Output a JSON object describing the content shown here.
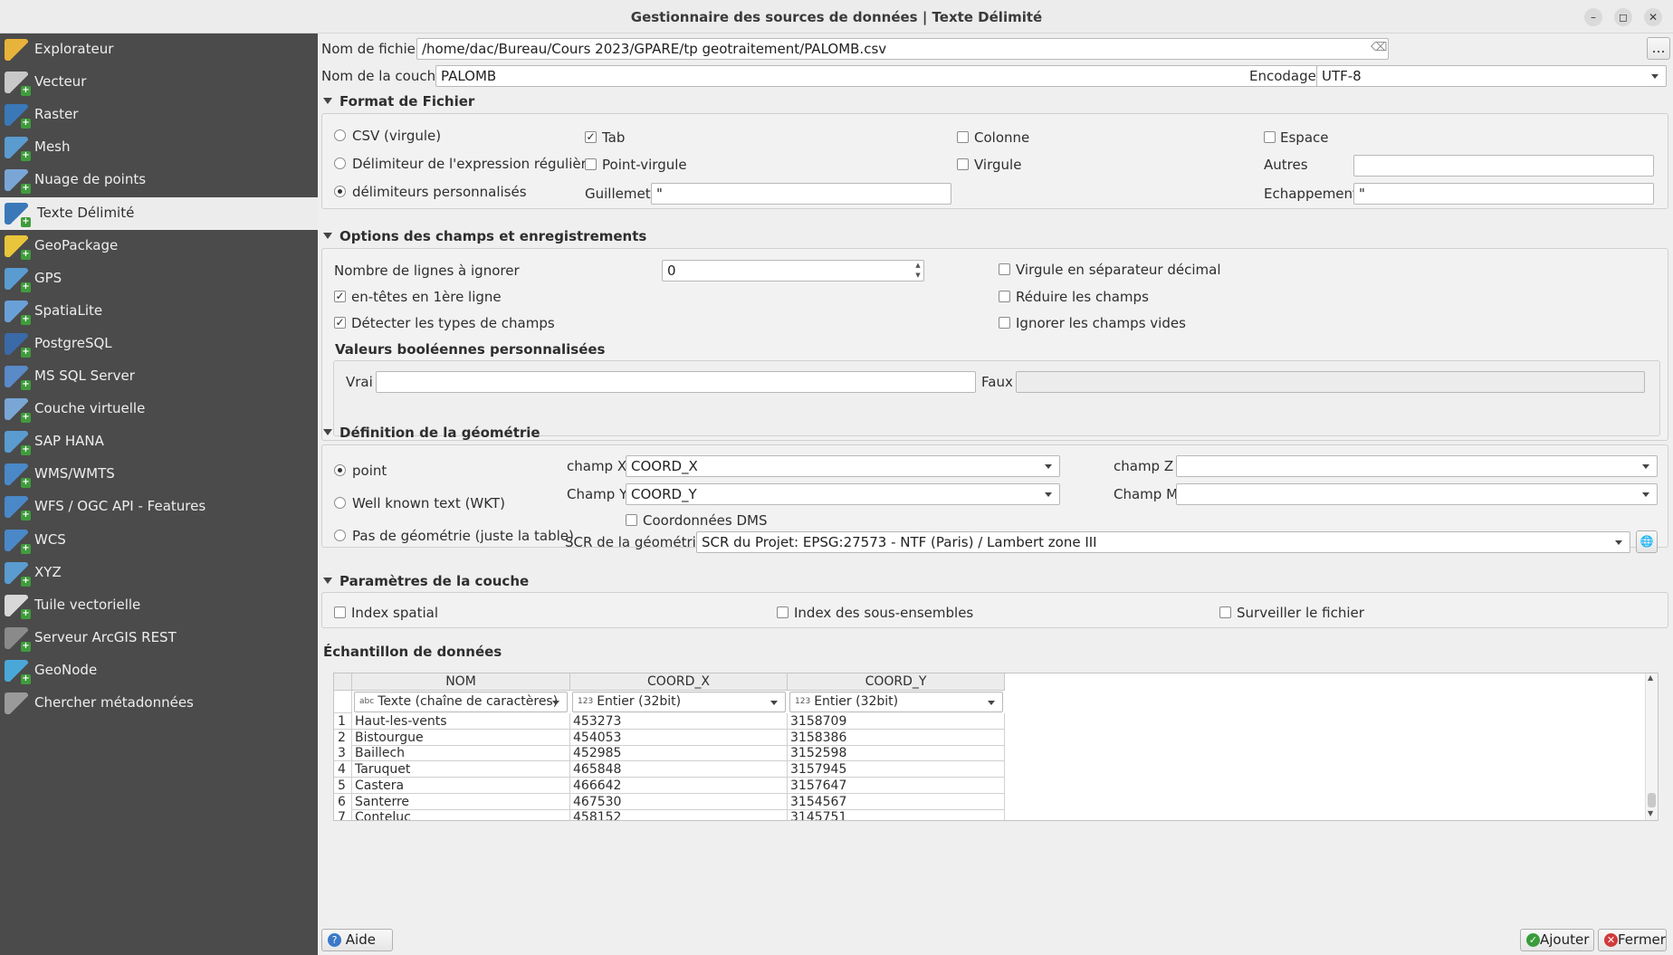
{
  "window": {
    "title": "Gestionnaire des sources de données | Texte Délimité",
    "controls": [
      "–",
      "◻",
      "✕"
    ]
  },
  "sidebar": {
    "items": [
      {
        "label": "Explorateur",
        "icon": "folder-icon",
        "color": "#e8b33a"
      },
      {
        "label": "Vecteur",
        "icon": "vector-icon",
        "color": "#c8c8c8"
      },
      {
        "label": "Raster",
        "icon": "raster-icon",
        "color": "#3a78b8"
      },
      {
        "label": "Mesh",
        "icon": "mesh-icon",
        "color": "#5a9bd0"
      },
      {
        "label": "Nuage de points",
        "icon": "point-cloud-icon",
        "color": "#7aa6d6"
      },
      {
        "label": "Texte Délimité",
        "icon": "delimited-text-icon",
        "color": "#3a78b8"
      },
      {
        "label": "GeoPackage",
        "icon": "geopackage-icon",
        "color": "#e8c53a"
      },
      {
        "label": "GPS",
        "icon": "gps-icon",
        "color": "#5a9bd0"
      },
      {
        "label": "SpatiaLite",
        "icon": "spatialite-icon",
        "color": "#6aa0d8"
      },
      {
        "label": "PostgreSQL",
        "icon": "postgresql-icon",
        "color": "#3a6aa8"
      },
      {
        "label": "MS SQL Server",
        "icon": "mssql-icon",
        "color": "#5a8ac8"
      },
      {
        "label": "Couche virtuelle",
        "icon": "virtual-layer-icon",
        "color": "#7aa6d6"
      },
      {
        "label": "SAP HANA",
        "icon": "sap-hana-icon",
        "color": "#5a9bd0"
      },
      {
        "label": "WMS/WMTS",
        "icon": "wms-icon",
        "color": "#4a88c8"
      },
      {
        "label": "WFS / OGC API - Features",
        "icon": "wfs-icon",
        "color": "#4a88c8"
      },
      {
        "label": "WCS",
        "icon": "wcs-icon",
        "color": "#4a88c8"
      },
      {
        "label": "XYZ",
        "icon": "xyz-icon",
        "color": "#5a9bd0"
      },
      {
        "label": "Tuile vectorielle",
        "icon": "vector-tile-icon",
        "color": "#d8d8d8"
      },
      {
        "label": "Serveur ArcGIS REST",
        "icon": "arcgis-icon",
        "color": "#8a8a8a"
      },
      {
        "label": "GeoNode",
        "icon": "geonode-icon",
        "color": "#4aa8d8"
      },
      {
        "label": "Chercher métadonnées",
        "icon": "search-icon",
        "color": "#9a9a9a"
      }
    ],
    "selected_index": 5
  },
  "file": {
    "label": "Nom de fichier",
    "value": "/home/dac/Bureau/Cours 2023/GPARE/tp geotraitement/PALOMB.csv",
    "browse_label": "…"
  },
  "layer": {
    "label": "Nom de la couche",
    "value": "PALOMB",
    "encoding_label": "Encodage",
    "encoding_value": "UTF-8"
  },
  "format": {
    "title": "Format de Fichier",
    "options": [
      "CSV (virgule)",
      "Délimiteur de l'expression régulière",
      "délimiteurs personnalisés"
    ],
    "selected": 2,
    "delimiters": {
      "tab": "Tab",
      "colonne": "Colonne",
      "espace": "Espace",
      "point_virgule": "Point-virgule",
      "virgule": "Virgule",
      "autres": "Autres",
      "tab_checked": "✓"
    },
    "guillemet_label": "Guillemet",
    "guillemet_value": "\"",
    "echappement_label": "Echappement",
    "echappement_value": "\""
  },
  "records": {
    "title": "Options des champs et enregistrements",
    "skip_lines_label": "Nombre de lignes à ignorer",
    "skip_lines_value": "0",
    "header_first_line": "en-têtes en 1ère ligne",
    "detect_types": "Détecter les types de champs",
    "decimal_comma": "Virgule en séparateur décimal",
    "trim_fields": "Réduire les champs",
    "ignore_empty": "Ignorer les champs vides",
    "check_mark": "✓",
    "bool_title": "Valeurs booléennes personnalisées",
    "true_label": "Vrai",
    "false_label": "Faux"
  },
  "geometry": {
    "title": "Définition de la géométrie",
    "options": [
      "point",
      "Well known text (WKT)",
      "Pas de géométrie (juste la table)"
    ],
    "selected": 0,
    "x_label": "champ X",
    "x_value": "COORD_X",
    "y_label": "Champ Y",
    "y_value": "COORD_Y",
    "z_label": "champ Z",
    "m_label": "Champ M",
    "dms_label": "Coordonnées DMS",
    "crs_label": "SCR de la géométrie",
    "crs_value": "SCR du Projet: EPSG:27573 - NTF (Paris) / Lambert zone III"
  },
  "layer_params": {
    "title": "Paramètres de la couche",
    "spatial_index": "Index spatial",
    "subset_index": "Index des sous-ensembles",
    "watch_file": "Surveiller le fichier"
  },
  "sample": {
    "title": "Échantillon de données",
    "columns": [
      "NOM",
      "COORD_X",
      "COORD_Y"
    ],
    "types": [
      {
        "prefix": "abc",
        "label": "Texte (chaîne de caractères)"
      },
      {
        "prefix": "123",
        "label": "Entier (32bit)"
      },
      {
        "prefix": "123",
        "label": "Entier (32bit)"
      }
    ],
    "rows": [
      [
        "1",
        "Haut-les-vents",
        "453273",
        "3158709"
      ],
      [
        "2",
        "Bistourgue",
        "454053",
        "3158386"
      ],
      [
        "3",
        "Baillech",
        "452985",
        "3152598"
      ],
      [
        "4",
        "Taruquet",
        "465848",
        "3157945"
      ],
      [
        "5",
        "Castera",
        "466642",
        "3157647"
      ],
      [
        "6",
        "Santerre",
        "467530",
        "3154567"
      ],
      [
        "7",
        "Conteluc",
        "458152",
        "3145751"
      ]
    ]
  },
  "footer": {
    "help_label": "Aide",
    "add_label": "Ajouter",
    "close_label": "Fermer"
  }
}
